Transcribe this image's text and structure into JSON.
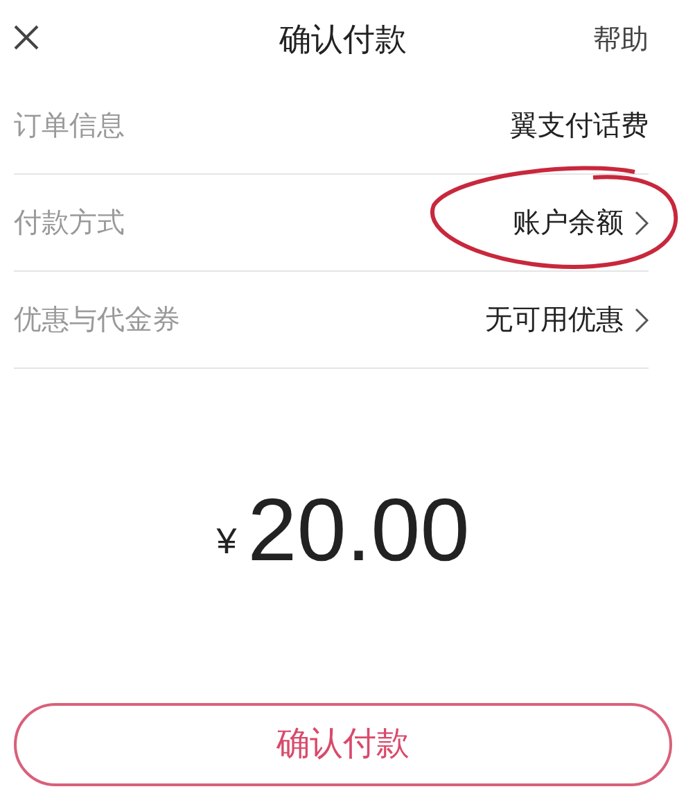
{
  "header": {
    "title": "确认付款",
    "help": "帮助"
  },
  "rows": [
    {
      "label": "订单信息",
      "value": "翼支付话费",
      "kind": "plain",
      "circled": false
    },
    {
      "label": "付款方式",
      "value": "账户余额",
      "kind": "link",
      "circled": true
    },
    {
      "label": "优惠与代金券",
      "value": "无可用优惠",
      "kind": "link",
      "circled": false
    }
  ],
  "amount": {
    "currency": "¥",
    "value": "20.00"
  },
  "confirm_button": "确认付款"
}
